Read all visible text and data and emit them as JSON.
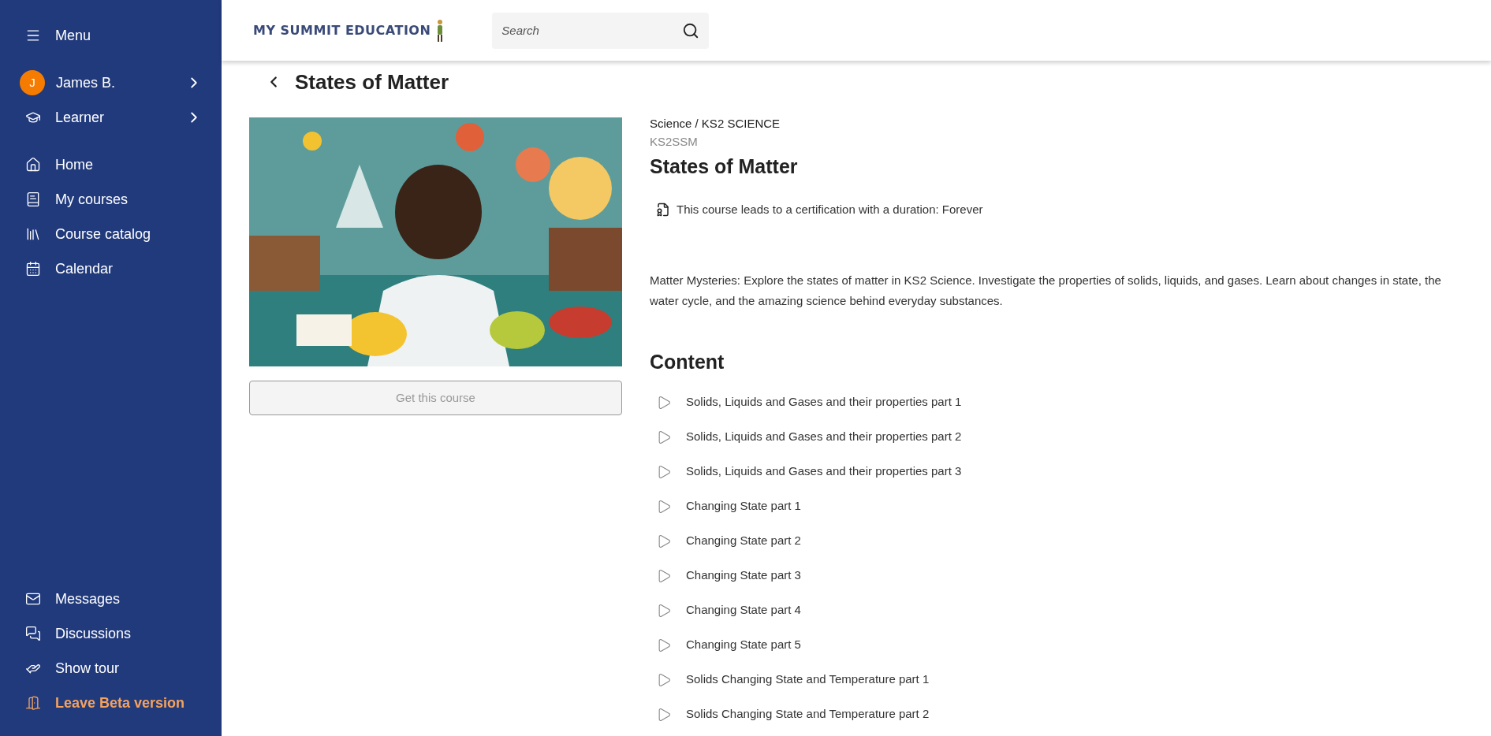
{
  "sidebar": {
    "menu_label": "Menu",
    "user": {
      "initial": "J",
      "name": "James B."
    },
    "role": "Learner",
    "nav_items": [
      {
        "label": "Home"
      },
      {
        "label": "My courses"
      },
      {
        "label": "Course catalog"
      },
      {
        "label": "Calendar"
      }
    ],
    "bottom_items": [
      {
        "label": "Messages",
        "kind": "normal"
      },
      {
        "label": "Discussions",
        "kind": "normal"
      },
      {
        "label": "Show tour",
        "kind": "normal"
      },
      {
        "label": "Leave Beta version",
        "kind": "accent"
      }
    ]
  },
  "header": {
    "logo": "MY SUMMIT EDUCATION",
    "search": {
      "placeholder": "Search"
    }
  },
  "page": {
    "title": "States of Matter",
    "get_course_button": {
      "label": "Get this course",
      "disabled": true
    },
    "breadcrumb": "Science / KS2 SCIENCE",
    "code": "KS2SSM",
    "course_title": "States of Matter",
    "certification": "This course leads to a certification with a duration: Forever",
    "description": "Matter Mysteries: Explore the states of matter in KS2 Science. Investigate the properties of solids, liquids, and gases. Learn about changes in state, the water cycle, and the amazing science behind everyday substances.",
    "content_heading": "Content",
    "lessons": [
      "Solids, Liquids and Gases and their properties part 1",
      "Solids, Liquids and Gases and their properties part 2",
      "Solids, Liquids and Gases and their properties part 3",
      "Changing State part 1",
      "Changing State part 2",
      "Changing State part 3",
      "Changing State part 4",
      "Changing State part 5",
      "Solids Changing State and Temperature part 1",
      "Solids Changing State and Temperature part 2"
    ]
  }
}
